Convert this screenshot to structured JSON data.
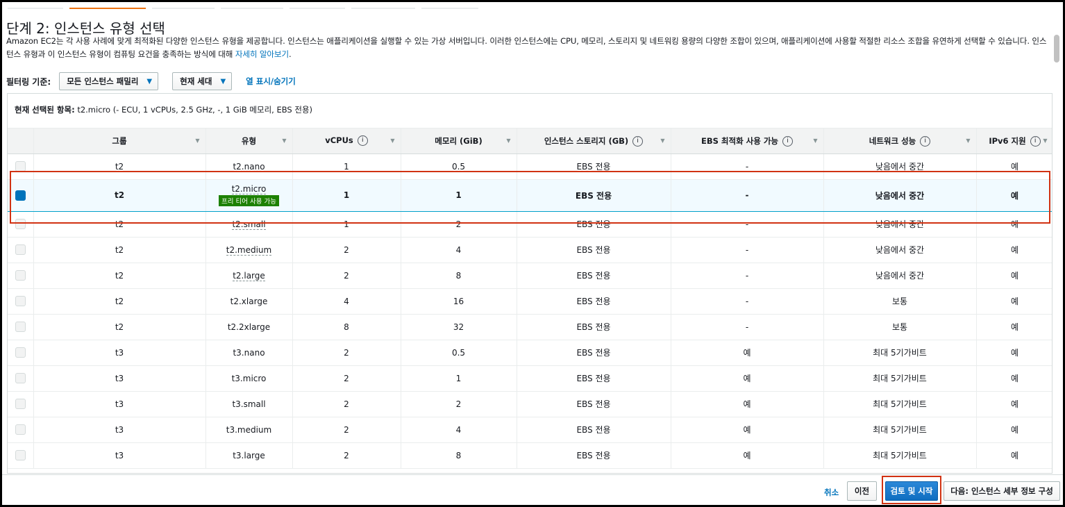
{
  "page": {
    "title": "단계 2: 인스턴스 유형 선택",
    "description": "Amazon EC2는 각 사용 사례에 맞게 최적화된 다양한 인스턴스 유형을 제공합니다. 인스턴스는 애플리케이션을 실행할 수 있는 가상 서버입니다. 이러한 인스턴스에는 CPU, 메모리, 스토리지 및 네트워킹 용량의 다양한 조합이 있으며, 애플리케이션에 사용할 적절한 리소스 조합을 유연하게 선택할 수 있습니다. 인스턴스 유형과 이 인스턴스 유형이 컴퓨팅 요건을 충족하는 방식에 대해 ",
    "learn_more": "자세히 알아보기",
    "desc_end": "."
  },
  "filters": {
    "label": "필터링 기준:",
    "family": "모든 인스턴스 패밀리",
    "generation": "현재 세대",
    "toggle_columns": "열 표시/숨기기"
  },
  "selection": {
    "label": "현재 선택된 항목:",
    "value": " t2.micro (- ECU, 1 vCPUs, 2.5 GHz, -, 1 GiB 메모리, EBS 전용)"
  },
  "columns": {
    "group": "그룹",
    "type": "유형",
    "vcpus": "vCPUs",
    "memory": "메모리 (GiB)",
    "storage": "인스턴스 스토리지 (GB)",
    "ebs": "EBS 최적화 사용 가능",
    "network": "네트워크 성능",
    "ipv6": "IPv6 지원"
  },
  "free_tier_badge": "프리 티어 사용 가능",
  "rows": [
    {
      "group": "t2",
      "type": "t2.nano",
      "vcpus": "1",
      "memory": "0.5",
      "storage": "EBS 전용",
      "ebs": "-",
      "network": "낮음에서 중간",
      "ipv6": "예"
    },
    {
      "group": "t2",
      "type": "t2.micro",
      "vcpus": "1",
      "memory": "1",
      "storage": "EBS 전용",
      "ebs": "-",
      "network": "낮음에서 중간",
      "ipv6": "예"
    },
    {
      "group": "t2",
      "type": "t2.small",
      "vcpus": "1",
      "memory": "2",
      "storage": "EBS 전용",
      "ebs": "-",
      "network": "낮음에서 중간",
      "ipv6": "예"
    },
    {
      "group": "t2",
      "type": "t2.medium",
      "vcpus": "2",
      "memory": "4",
      "storage": "EBS 전용",
      "ebs": "-",
      "network": "낮음에서 중간",
      "ipv6": "예"
    },
    {
      "group": "t2",
      "type": "t2.large",
      "vcpus": "2",
      "memory": "8",
      "storage": "EBS 전용",
      "ebs": "-",
      "network": "낮음에서 중간",
      "ipv6": "예"
    },
    {
      "group": "t2",
      "type": "t2.xlarge",
      "vcpus": "4",
      "memory": "16",
      "storage": "EBS 전용",
      "ebs": "-",
      "network": "보통",
      "ipv6": "예"
    },
    {
      "group": "t2",
      "type": "t2.2xlarge",
      "vcpus": "8",
      "memory": "32",
      "storage": "EBS 전용",
      "ebs": "-",
      "network": "보통",
      "ipv6": "예"
    },
    {
      "group": "t3",
      "type": "t3.nano",
      "vcpus": "2",
      "memory": "0.5",
      "storage": "EBS 전용",
      "ebs": "예",
      "network": "최대 5기가비트",
      "ipv6": "예"
    },
    {
      "group": "t3",
      "type": "t3.micro",
      "vcpus": "2",
      "memory": "1",
      "storage": "EBS 전용",
      "ebs": "예",
      "network": "최대 5기가비트",
      "ipv6": "예"
    },
    {
      "group": "t3",
      "type": "t3.small",
      "vcpus": "2",
      "memory": "2",
      "storage": "EBS 전용",
      "ebs": "예",
      "network": "최대 5기가비트",
      "ipv6": "예"
    },
    {
      "group": "t3",
      "type": "t3.medium",
      "vcpus": "2",
      "memory": "4",
      "storage": "EBS 전용",
      "ebs": "예",
      "network": "최대 5기가비트",
      "ipv6": "예"
    },
    {
      "group": "t3",
      "type": "t3.large",
      "vcpus": "2",
      "memory": "8",
      "storage": "EBS 전용",
      "ebs": "예",
      "network": "최대 5기가비트",
      "ipv6": "예"
    }
  ],
  "footer": {
    "cancel": "취소",
    "previous": "이전",
    "review_launch": "검토 및 시작",
    "next": "다음: 인스턴스 세부 정보 구성"
  },
  "colors": {
    "accent_tab": "#ec7211",
    "primary_button": "#0f6ec0",
    "highlight": "#d13212",
    "link": "#0073bb",
    "badge": "#1d8102"
  }
}
